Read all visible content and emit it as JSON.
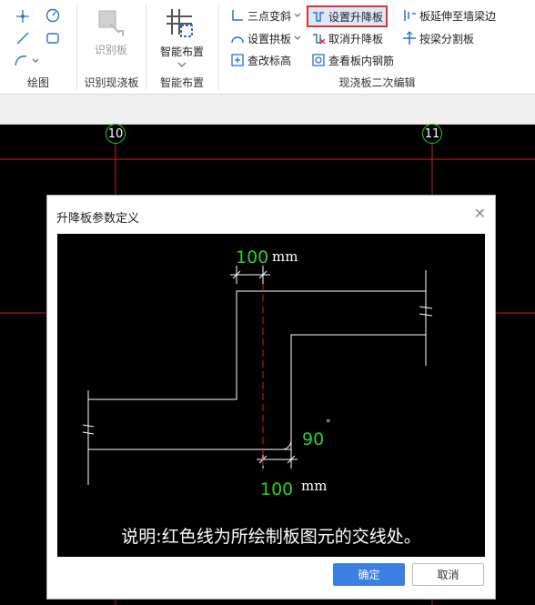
{
  "ribbon": {
    "groups": {
      "draw": "绘图",
      "identify": "识别现浇板",
      "smart": "智能布置",
      "edit": "现浇板二次编辑"
    },
    "buttons": {
      "identify_slab": "识别板",
      "smart_layout": "智能布置",
      "three_point_slope": "三点变斜",
      "set_arch_slab": "设置拱板",
      "check_elevation": "查改标高",
      "set_raise_slab": "设置升降板",
      "cancel_raise_slab": "取消升降板",
      "view_slab_rebar": "查看板内钢筋",
      "extend_slab_to_wall": "板延伸至墙梁边",
      "split_by_beam": "按梁分割板"
    }
  },
  "grid": {
    "axis_left": "10",
    "axis_right": "11"
  },
  "dialog": {
    "title": "升降板参数定义",
    "diagram": {
      "top_dim_value": "100",
      "top_dim_unit": "mm",
      "bottom_dim_value": "100",
      "bottom_dim_unit": "mm",
      "angle_value": "90",
      "angle_unit": "°",
      "note": "说明:红色线为所绘制板图元的交线处。"
    },
    "ok_label": "确定",
    "cancel_label": "取消"
  },
  "colors": {
    "accent": "#3b7fe0",
    "highlight_border": "#e03030",
    "dimension_text": "#2bd02b",
    "grid_line": "#d02020"
  }
}
